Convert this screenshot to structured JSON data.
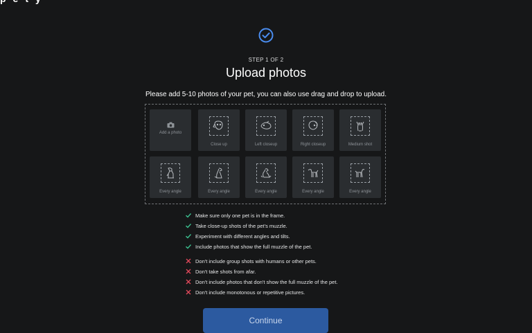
{
  "app": {
    "logo_text": "pety"
  },
  "header": {
    "step_label": "STEP 1 OF 2",
    "title": "Upload photos",
    "subtitle": "Please add 5-10 photos of your pet, you can also use drag and drop to upload."
  },
  "tiles": [
    {
      "label": "Add a photo",
      "icon": "camera-icon"
    },
    {
      "label": "Close up",
      "icon": "dog-face-icon"
    },
    {
      "label": "Left closeup",
      "icon": "dog-face-left-icon"
    },
    {
      "label": "Right closeup",
      "icon": "dog-face-right-icon"
    },
    {
      "label": "Medium shot",
      "icon": "dog-front-icon"
    },
    {
      "label": "Every angle",
      "icon": "dog-sitting-icon"
    },
    {
      "label": "Every angle",
      "icon": "dog-sitting-side-icon"
    },
    {
      "label": "Every angle",
      "icon": "dog-lying-icon"
    },
    {
      "label": "Every angle",
      "icon": "dog-standing-icon"
    },
    {
      "label": "Every angle",
      "icon": "dog-standing-side-icon"
    }
  ],
  "dos": [
    "Make sure only one pet is in the frame.",
    "Take close-up shots of the pet's muzzle.",
    "Experiment with different angles and tilts.",
    "Include photos that show the full muzzle of the pet."
  ],
  "donts": [
    "Don't include group shots with humans or other pets.",
    "Don't take shots from afar.",
    "Don't include photos that don't show the full muzzle of the pet.",
    "Don't include monotonous or repetitive pictures."
  ],
  "actions": {
    "continue_label": "Continue"
  },
  "colors": {
    "background": "#161718",
    "accent": "#2c5aa0",
    "check": "#3bbf8f",
    "cross": "#e0485a",
    "step_icon": "#4a8df0"
  }
}
